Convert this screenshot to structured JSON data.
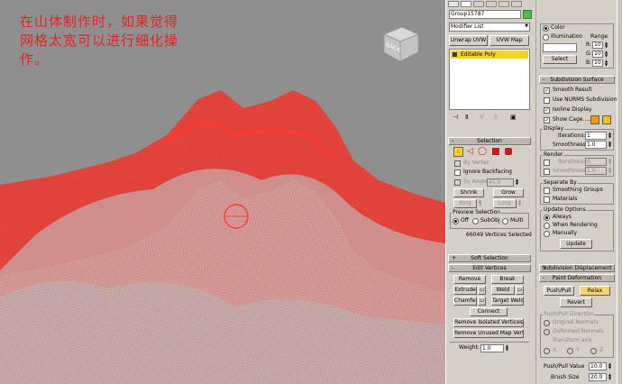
{
  "viewport": {
    "annotation_line1": "在山体制作时，如果觉得",
    "annotation_line2": "网格太宽可以进行细化操",
    "annotation_line3": "作。",
    "viewcube_label": "BACK",
    "mesh_color": "#e0201c",
    "background_color": "#8f8f8f"
  },
  "modify_panel": {
    "object_name": "Group15787",
    "modifier_list": "Modifier List",
    "unwrap_uvw": "Unwrap UVW",
    "uvw_map": "UVW Map",
    "stack_item": "Editable Poly"
  },
  "selection": {
    "title": "Selection",
    "by_vertex": "By Vertex",
    "ignore_backfacing": "Ignore Backfacing",
    "by_angle": "By Angle:",
    "by_angle_value": "45.0",
    "shrink": "Shrink",
    "grow": "Grow",
    "ring": "Ring",
    "loop": "Loop",
    "preview_title": "Preview Selection",
    "preview_off": "Off",
    "preview_subobj": "SubObj",
    "preview_multi": "Multi",
    "status": "66049 Vertices Selected"
  },
  "soft_selection": {
    "title": "Soft Selection"
  },
  "edit_vertices": {
    "title": "Edit Vertices",
    "remove": "Remove",
    "break": "Break",
    "extrude": "Extrude",
    "weld": "Weld",
    "chamfer": "Chamfer",
    "target_weld": "Target Weld",
    "connect": "Connect",
    "remove_isolated": "Remove Isolated Vertices",
    "remove_unused": "Remove Unused Map Verts",
    "weight_label": "Weight:",
    "weight_value": "1.0"
  },
  "color_group": {
    "color": "Color",
    "illumination": "Illumination",
    "range": "Range",
    "r_label": "R:",
    "g_label": "G:",
    "b_label": "B:",
    "r_value": "10",
    "g_value": "10",
    "b_value": "10",
    "select": "Select"
  },
  "subdivision_surface": {
    "title": "Subdivision Surface",
    "smooth_result": "Smooth Result",
    "use_nurms": "Use NURMS Subdivision",
    "isoline": "Isoline Display",
    "show_cage": "Show Cage.......",
    "cage_color_1": "#f09a1a",
    "cage_color_2": "#f0c01a",
    "display_title": "Display",
    "iterations": "Iterations:",
    "iterations_value": "1",
    "smoothness": "Smoothness:",
    "smoothness_value": "1.0",
    "render_title": "Render",
    "render_iterations": "Iterations:",
    "render_iterations_value": "0",
    "render_smoothness": "Smoothness:",
    "render_smoothness_value": "1.0",
    "separate_title": "Separate By",
    "smoothing_groups": "Smoothing Groups",
    "materials": "Materials",
    "update_title": "Update Options",
    "always": "Always",
    "when_rendering": "When Rendering",
    "manually": "Manually",
    "update": "Update"
  },
  "subdivision_displacement": {
    "title": "Subdivision Displacement"
  },
  "paint_deformation": {
    "title": "Paint Deformation",
    "push_pull": "Push/Pull",
    "relax": "Relax",
    "revert": "Revert",
    "direction_title": "Push/Pull Direction",
    "original_normals": "Original Normals",
    "deformed_normals": "Deformed Normals",
    "transform_axis": "Transform axis",
    "x": "X",
    "y": "Y",
    "z": "Z",
    "push_pull_value_label": "Push/Pull Value",
    "push_pull_value": "10.0",
    "brush_size": "Brush Size",
    "brush_size_value": "20.0"
  }
}
